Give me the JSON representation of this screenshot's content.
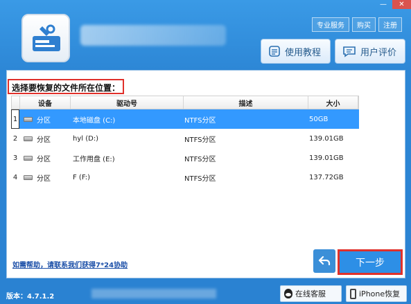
{
  "window": {
    "minimize_glyph": "—",
    "close_glyph": "✕"
  },
  "header": {
    "links": [
      "专业服务",
      "购买",
      "注册"
    ],
    "tutorial_button": "使用教程",
    "review_button": "用户评价"
  },
  "main": {
    "section_label": "选择要恢复的文件所在位置：",
    "table": {
      "columns": [
        "",
        "设备",
        "驱动号",
        "描述",
        "大小"
      ],
      "rows": [
        {
          "index": "1",
          "device": "分区",
          "drive": "本地磁盘 (C:)",
          "description": "NTFS分区",
          "size": "50GB",
          "selected": true
        },
        {
          "index": "2",
          "device": "分区",
          "drive": "hyl (D:)",
          "description": "NTFS分区",
          "size": "139.01GB",
          "selected": false
        },
        {
          "index": "3",
          "device": "分区",
          "drive": "工作用盘 (E:)",
          "description": "NTFS分区",
          "size": "139.01GB",
          "selected": false
        },
        {
          "index": "4",
          "device": "分区",
          "drive": "F (F:)",
          "description": "NTFS分区",
          "size": "137.72GB",
          "selected": false
        }
      ]
    },
    "help_link": "如需帮助，请联系我们获得7*24协助",
    "next_button": "下一步"
  },
  "footer": {
    "version": "版本：4.7.1.2",
    "service_button": "在线客服",
    "iphone_button": "iPhone恢复"
  },
  "colors": {
    "accent": "#2d87d6",
    "selection": "#3399ff",
    "highlight_border": "#e0302a"
  },
  "icons": [
    "drive-logo-icon",
    "document-icon",
    "chat-icon",
    "disk-icon",
    "back-arrow-icon",
    "qq-icon",
    "phone-icon"
  ]
}
